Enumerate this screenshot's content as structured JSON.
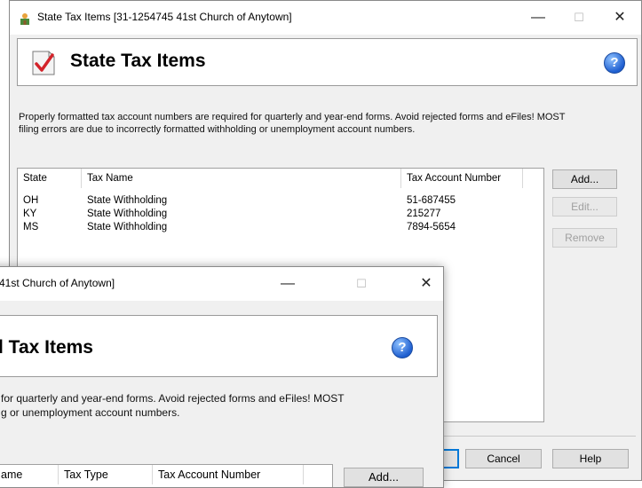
{
  "back_window": {
    "title": "State Tax Items [31-1254745 41st Church of Anytown]",
    "header_title": "State Tax Items",
    "description_line1": "Properly formatted tax account numbers are required for quarterly and year-end forms. Avoid rejected forms and eFiles! MOST",
    "description_line2": "filing errors are due to incorrectly formatted withholding or unemployment account numbers.",
    "columns": [
      "State",
      "Tax Name",
      "Tax Account Number"
    ],
    "rows": [
      {
        "state": "OH",
        "tax_name": "State Withholding",
        "account": "51-687455"
      },
      {
        "state": "KY",
        "tax_name": "State Withholding",
        "account": "215277"
      },
      {
        "state": "MS",
        "tax_name": "State Withholding",
        "account": "7894-5654"
      }
    ],
    "buttons": {
      "add": "Add...",
      "edit": "Edit...",
      "remove": "Remove",
      "cancel": "Cancel",
      "help": "Help"
    }
  },
  "front_window": {
    "title": "41st Church of Anytown]",
    "header_title": "l Tax Items",
    "description_line1": "for quarterly and year-end forms. Avoid rejected forms and eFiles! MOST",
    "description_line2": "g or unemployment account numbers.",
    "columns": [
      "Name",
      "Tax Type",
      "Tax Account Number"
    ],
    "buttons": {
      "add": "Add..."
    }
  },
  "window_controls": {
    "minimize": "—",
    "maximize": "☐",
    "close": "✕"
  },
  "icons": {
    "app": "church-icon",
    "header": "checklist-icon",
    "help": "help-icon"
  },
  "help_glyph": "?"
}
